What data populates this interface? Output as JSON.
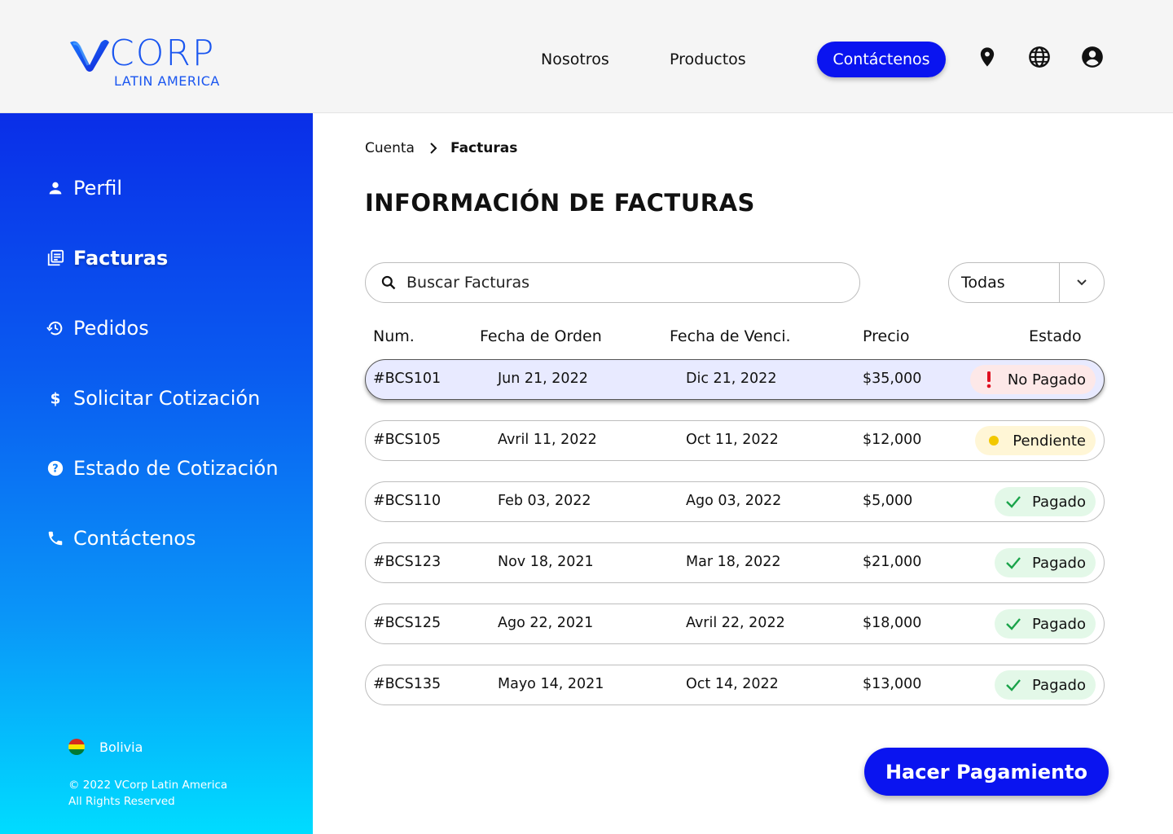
{
  "brand": {
    "name": "CORP",
    "region": "LATIN AMERICA",
    "accent": "#1a56f0"
  },
  "nav": {
    "links": [
      "Nosotros",
      "Productos"
    ],
    "cta": "Contáctenos",
    "icons": [
      "location-pin-icon",
      "globe-icon",
      "account-circle-icon"
    ]
  },
  "sidebar": {
    "items": [
      {
        "label": "Perfil",
        "icon": "person-icon"
      },
      {
        "label": "Facturas",
        "icon": "invoices-icon",
        "active": true
      },
      {
        "label": "Pedidos",
        "icon": "history-icon"
      },
      {
        "label": "Solicitar Cotización",
        "icon": "dollar-icon"
      },
      {
        "label": "Estado de Cotización",
        "icon": "help-circle-icon"
      },
      {
        "label": "Contáctenos",
        "icon": "phone-icon"
      }
    ],
    "country": "Bolivia",
    "copyright_1": "© 2022 VCorp Latin America",
    "copyright_2": "All Rights Reserved",
    "gradient": [
      "#0a2ee8",
      "#00dcff"
    ]
  },
  "breadcrumb": {
    "parent": "Cuenta",
    "current": "Facturas"
  },
  "page_title": "INFORMACIÓN DE FACTURAS",
  "search": {
    "placeholder": "Buscar Facturas",
    "value": ""
  },
  "filter": {
    "selected": "Todas"
  },
  "table": {
    "headers": {
      "num": "Num.",
      "order_date": "Fecha de Orden",
      "due_date": "Fecha de Venci.",
      "price": "Precio",
      "status": "Estado"
    },
    "rows": [
      {
        "num": "#BCS101",
        "order_date": "Jun 21, 2022",
        "due_date": "Dic 21, 2022",
        "price": "$35,000",
        "status": "No Pagado",
        "status_type": "unpaid"
      },
      {
        "num": "#BCS105",
        "order_date": "Avril 11, 2022",
        "due_date": "Oct 11, 2022",
        "price": "$12,000",
        "status": "Pendiente",
        "status_type": "pending"
      },
      {
        "num": "#BCS110",
        "order_date": "Feb 03, 2022",
        "due_date": "Ago 03, 2022",
        "price": "$5,000",
        "status": "Pagado",
        "status_type": "paid"
      },
      {
        "num": "#BCS123",
        "order_date": "Nov 18, 2021",
        "due_date": "Mar 18, 2022",
        "price": "$21,000",
        "status": "Pagado",
        "status_type": "paid"
      },
      {
        "num": "#BCS125",
        "order_date": "Ago 22, 2021",
        "due_date": "Avril 22, 2022",
        "price": "$18,000",
        "status": "Pagado",
        "status_type": "paid"
      },
      {
        "num": "#BCS135",
        "order_date": "Mayo 14, 2021",
        "due_date": "Oct 14, 2022",
        "price": "$13,000",
        "status": "Pagado",
        "status_type": "paid"
      }
    ]
  },
  "pay_button": "Hacer Pagamiento",
  "colors": {
    "primary_button": "#0a14f0",
    "unpaid": "#e01020",
    "pending": "#f2c800",
    "paid": "#1aa34a"
  }
}
